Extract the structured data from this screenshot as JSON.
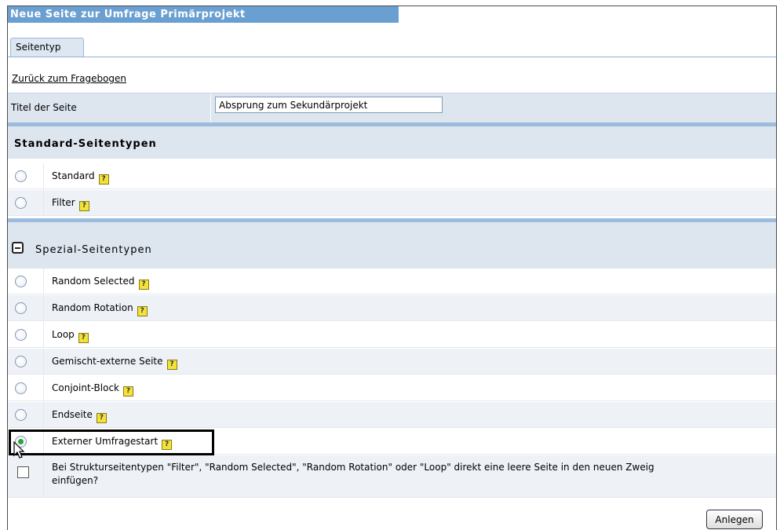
{
  "window": {
    "title": "Neue Seite zur Umfrage Primärprojekt"
  },
  "tabs": [
    {
      "label": "Seitentyp"
    }
  ],
  "back_link": "Zurück zum Fragebogen",
  "page_title": {
    "label": "Titel der Seite",
    "value": "Absprung zum Sekundärprojekt"
  },
  "standard_section": {
    "heading": "Standard-Seitentypen",
    "options": [
      {
        "label": "Standard",
        "checked": false
      },
      {
        "label": "Filter",
        "checked": false
      }
    ]
  },
  "special_section": {
    "heading": "Spezial-Seitentypen",
    "expanded": true,
    "options": [
      {
        "label": "Random Selected",
        "checked": false
      },
      {
        "label": "Random Rotation",
        "checked": false
      },
      {
        "label": "Loop",
        "checked": false
      },
      {
        "label": "Gemischt-externe Seite",
        "checked": false
      },
      {
        "label": "Conjoint-Block",
        "checked": false
      },
      {
        "label": "Endseite",
        "checked": false
      },
      {
        "label": "Externer Umfragestart",
        "checked": true
      }
    ]
  },
  "insert_empty_page": {
    "label_line1": "Bei Strukturseitentypen \"Filter\", \"Random Selected\", \"Random Rotation\" oder \"Loop\" direkt eine leere Seite in den neuen Zweig",
    "label_line2": "einfügen?",
    "checked": false
  },
  "help_icon_glyph": "?",
  "buttons": {
    "create": "Anlegen"
  },
  "colors": {
    "title_bar": "#6a9fd2",
    "section_bg": "#dde5ef",
    "section_border": "#9bbcdc",
    "selected_radio": "#2aa53a",
    "help_icon": "#f3e23a"
  }
}
